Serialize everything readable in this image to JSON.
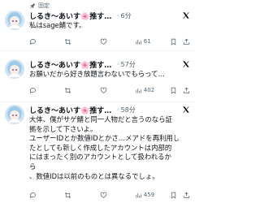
{
  "pinned_label": "固定",
  "posts": [
    {
      "author": "しるき～あいす🌸推すぞしるく…",
      "separator": "·",
      "time": "6分",
      "lines": [
        "私はsage鯖です。"
      ],
      "stats": {
        "replies": "",
        "reposts": "",
        "likes": "",
        "views": "61"
      }
    },
    {
      "author": "しるき～あいす🌸推すぞしるく…",
      "separator": "·",
      "time": "57分",
      "lines": [
        "お願いだから好き放題言わないでもらって…"
      ],
      "stats": {
        "replies": "",
        "reposts": "",
        "likes": "",
        "views": "402"
      }
    },
    {
      "author": "しるき～あいす🌸推すぞしるく…",
      "separator": "·",
      "time": "58分",
      "lines": [
        "大体、僕がサゲ鯖と同一人物だと言うのなら証",
        "拠を示して下さいよ。",
        "ユーザーIDとか数値IDとかさ…メアドを再利用し",
        "たとしても新しく作成したアカウントは内部的",
        "にはまったく別のアカウントとして扱われるか",
        "ら",
        "、数値IDは以前のものとは異なるでしょ。"
      ],
      "stats": {
        "replies": "",
        "reposts": "",
        "likes": "",
        "views": "459"
      }
    }
  ],
  "icons": {
    "pin": "pin-icon",
    "x_logo": "x-logo-icon",
    "reply": "reply-icon",
    "repost": "repost-icon",
    "like": "like-icon",
    "views": "views-icon",
    "bookmark": "bookmark-icon",
    "share": "share-icon"
  },
  "colors": {
    "text": "#0f1419",
    "secondary": "#536471",
    "divider": "#eff3f4"
  }
}
